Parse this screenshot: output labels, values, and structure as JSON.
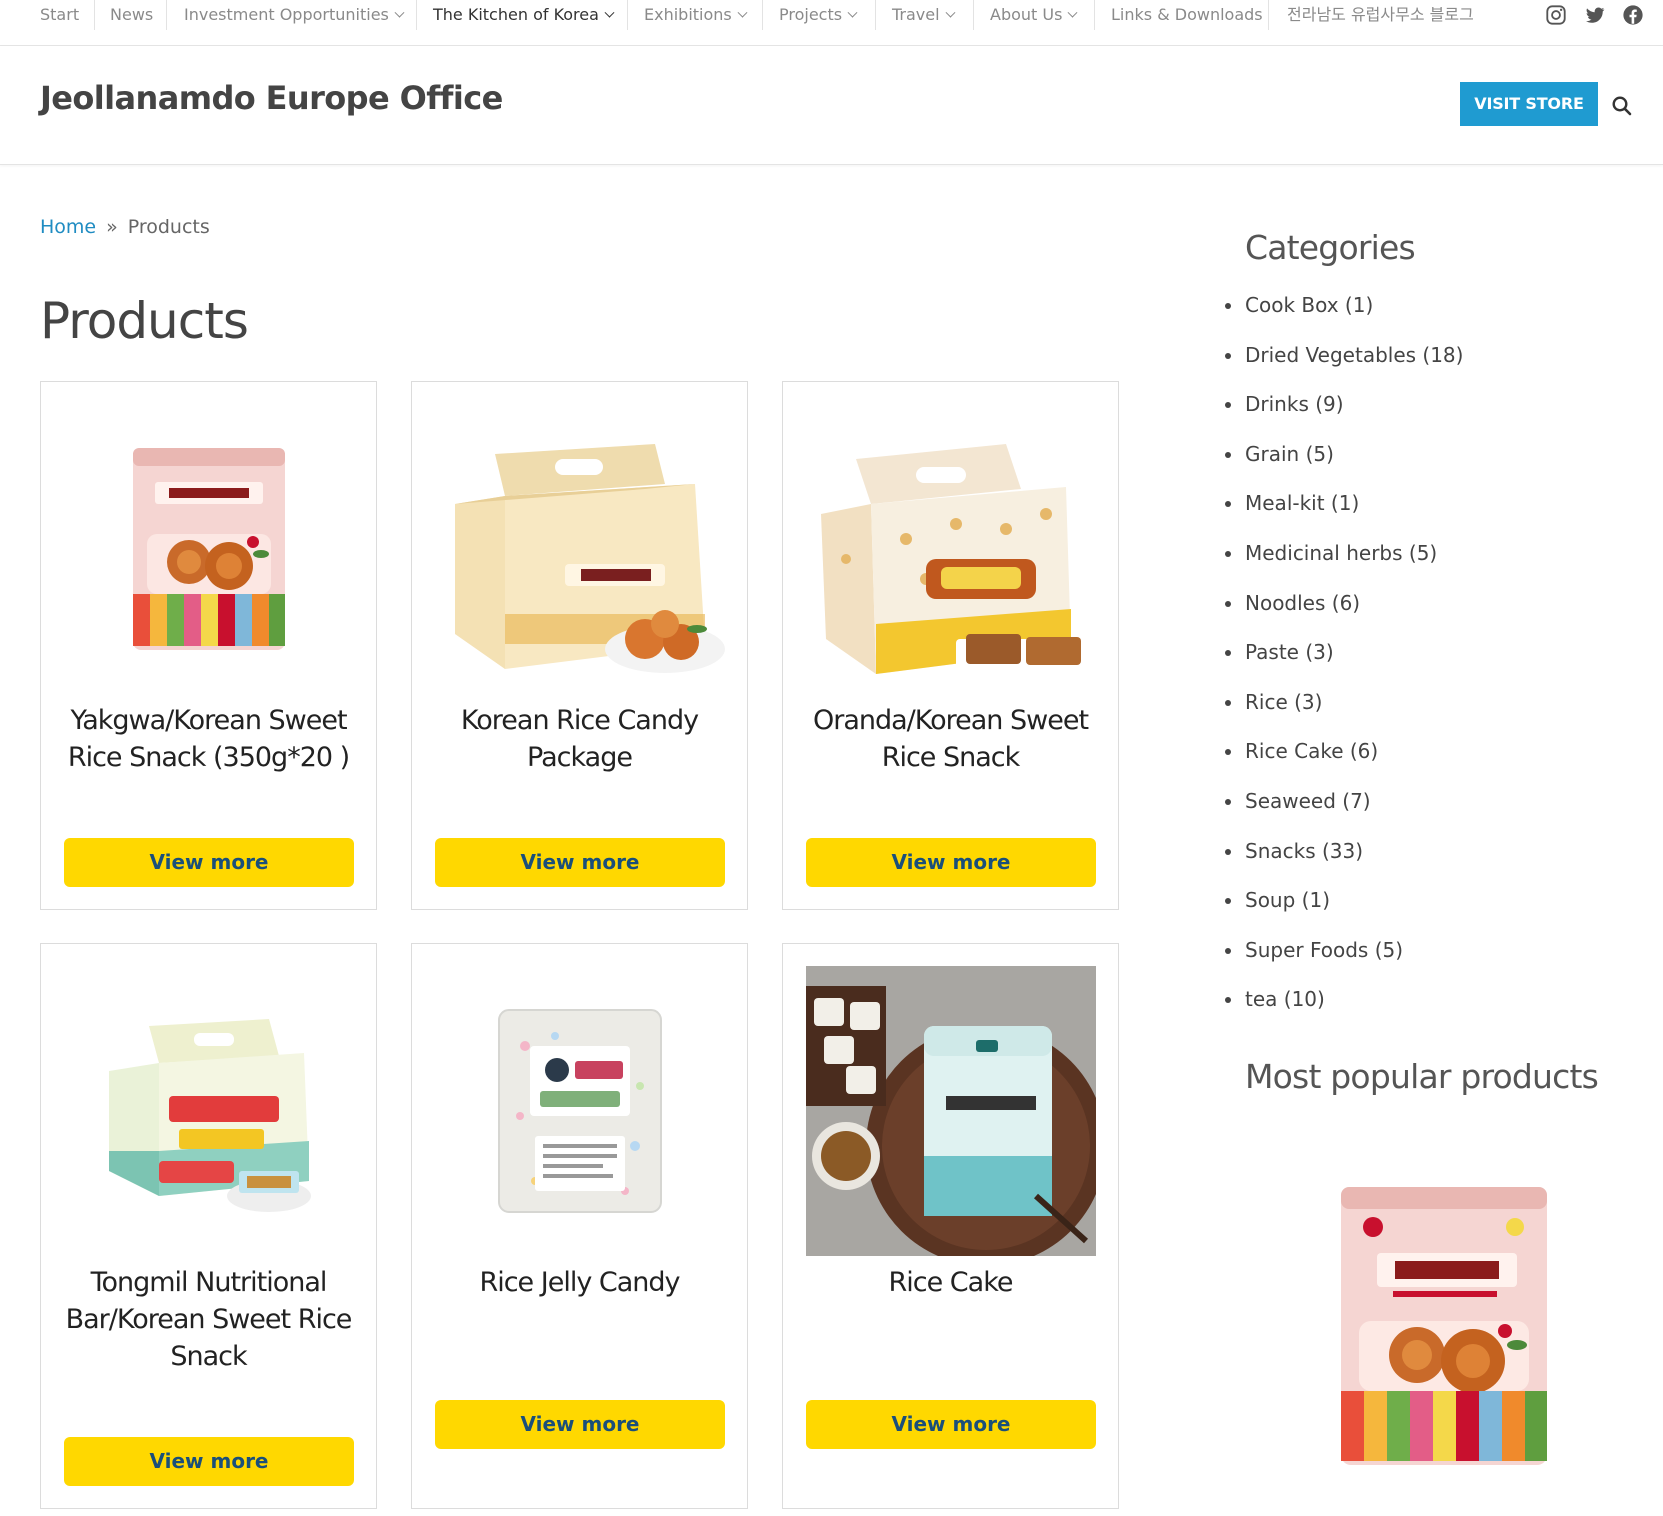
{
  "topnav": {
    "items": [
      {
        "label": "Start"
      },
      {
        "label": "News"
      },
      {
        "label": "Investment Opportunities"
      },
      {
        "label": "The Kitchen of Korea"
      },
      {
        "label": "Exhibitions"
      },
      {
        "label": "Projects"
      },
      {
        "label": "Travel"
      },
      {
        "label": "About Us"
      },
      {
        "label": "Links & Downloads"
      },
      {
        "label": "전라남도 유럽사무소 블로그"
      }
    ],
    "social": [
      "instagram-icon",
      "twitter-icon",
      "facebook-icon"
    ]
  },
  "header": {
    "site_title": "Jeollanamdo Europe Office",
    "visit_store": "VISIT STORE"
  },
  "breadcrumb": {
    "home": "Home",
    "separator": "»",
    "current": "Products"
  },
  "page": {
    "title": "Products"
  },
  "products": [
    {
      "name": "Yakgwa/Korean Sweet Rice Snack (350g*20 )",
      "button": "View more"
    },
    {
      "name": "Korean Rice Candy Package",
      "button": "View more"
    },
    {
      "name": "Oranda/Korean Sweet Rice Snack",
      "button": "View more"
    },
    {
      "name": "Tongmil Nutritional Bar/Korean Sweet Rice Snack",
      "button": "View more"
    },
    {
      "name": "Rice Jelly Candy",
      "button": "View more"
    },
    {
      "name": "Rice Cake",
      "button": "View more"
    }
  ],
  "sidebar": {
    "categories_title": "Categories",
    "categories": [
      "Cook Box (1)",
      "Dried Vegetables (18)",
      "Drinks (9)",
      "Grain (5)",
      "Meal-kit (1)",
      "Medicinal herbs (5)",
      "Noodles (6)",
      "Paste (3)",
      "Rice (3)",
      "Rice Cake (6)",
      "Seaweed (7)",
      "Snacks (33)",
      "Soup (1)",
      "Super Foods (5)",
      "tea (10)"
    ],
    "popular_title": "Most popular products"
  },
  "colors": {
    "accent_blue": "#1f9bd1",
    "button_yellow": "#ffd800",
    "button_text": "#1a4f7a",
    "link_blue": "#1f8cc2"
  }
}
